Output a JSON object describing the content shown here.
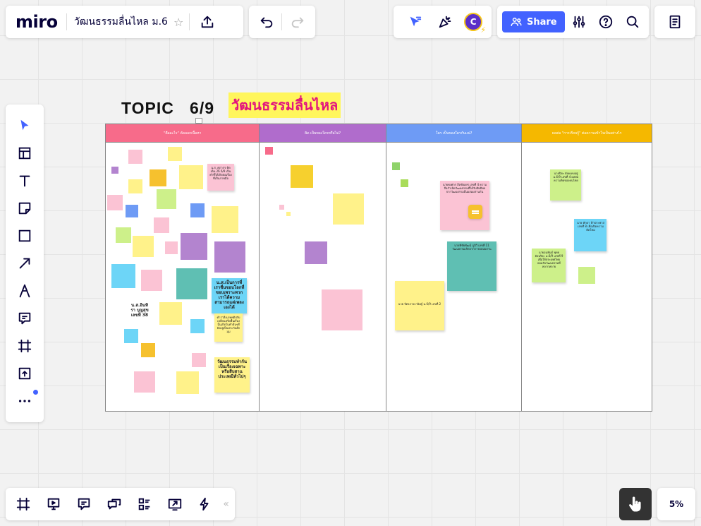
{
  "app": {
    "logo": "miro",
    "board_title": "วัฒนธรรมลื่นไหล ม.6",
    "share_label": "Share",
    "avatar_initial": "C",
    "zoom": "5%"
  },
  "colors": {
    "accent": "#4262ff",
    "col1": "#f76b8a",
    "col2": "#b06ccc",
    "col3": "#6e9bf5",
    "col4": "#f5b800",
    "yellow": "#fff28a",
    "pink": "#fbc3d4",
    "purple": "#b384cf",
    "blue": "#6dd5f7",
    "teal": "#5fbfb3",
    "green": "#cdf08a"
  },
  "icons": {
    "top": [
      "upload-icon",
      "undo-icon",
      "redo-icon",
      "cursor-filter-icon",
      "celebrate-icon",
      "share-people-icon",
      "settings-sliders-icon",
      "help-icon",
      "search-icon",
      "notes-icon"
    ],
    "left_toolbar": [
      "select-icon",
      "templates-icon",
      "text-icon",
      "sticky-note-icon",
      "shape-icon",
      "arrow-icon",
      "pen-icon",
      "comment-icon",
      "frame-icon",
      "upload-icon",
      "more-icon"
    ],
    "bottom": [
      "frames-icon",
      "presentation-icon",
      "comments-icon",
      "chat-icon",
      "cards-icon",
      "screen-share-icon",
      "lightning-icon",
      "collapse-icon",
      "present-hand-icon"
    ]
  },
  "board": {
    "topic_label": "TOPIC",
    "topic_number": "6/9",
    "subject": "วัฒนธรรมลื่นไหล",
    "columns": [
      {
        "header": "\"คืออะไร\" คัดลอกเนื้อหา"
      },
      {
        "header": "ผิด เป็นของใครหรือไม่?"
      },
      {
        "header": "ใคร เป็นของใครกันแน่?"
      },
      {
        "header": "ผลต่อ \"การเรียนรู้\" ต่อความเข้าใจเป็นอย่างไร"
      }
    ],
    "notes_col1": [
      {
        "text": "น.ส. ศุภากร\nคิดเห็น 26 6/9\nเป็นคำที่ได้เกิดต่อเรื่องที่เป็นภาพมือ"
      },
      {
        "text": "น.ส.อินทิรา\nบุญสุข\nเลขที่ 38"
      },
      {
        "text": "น.ส.เป็นการที่เราชื่นชอบโลกที่ชอบเพราะพวกเราได้ความสามารถแต่เพลงเองได้"
      },
      {
        "text": "คำว่าสิ่งเภทคติปรับเปลี่ยนหรือพื้นเรื่องนั้นเกิดในคำต้นๆที่ยังอยู่เป็นประกันอีกมุม"
      },
      {
        "text": "วัฒนธรรมทำกันเป็นเรื่องเฉพาะหรือสืบสานประเพณีทั่วไปๆ"
      }
    ],
    "notes_col3": [
      {
        "text": "นายพงศกร ลือชัยเดช เลขที่ 4\nความถือกำเนิดวัฒนธรรมที่ได้รับอิทธิพลจากวัฒนธรรมอื่นผสมผสานกัน"
      },
      {
        "text": "นายพิชัยพัฒน์ ภูมิวิ เลขที่ 11\nวัฒนธรรมเกิดจากการผสมผสาน"
      },
      {
        "text": "นาย จิตรภาค กนิษฐ์ ม.6/9 เลขที่ 2"
      }
    ],
    "notes_col4": [
      {
        "text": "นายปิยะ ยังคงคงอยู่\nม.6/9 เลขที่ 4\nผลต่อความคิดของคนไทย"
      },
      {
        "text": "นาย ศักดา ฟ้าประพาส\nเลขที่ 8\nเพื่อเปิดความคิดใหม่"
      },
      {
        "text": "นายอนพันธ์ พุทธอัจฉริยะ\nม.6/9 เลขที่ 9\nเพื่อให้ประเทศไทยยอมรับวัฒนธรรมที่หลากหลาย"
      }
    ]
  }
}
